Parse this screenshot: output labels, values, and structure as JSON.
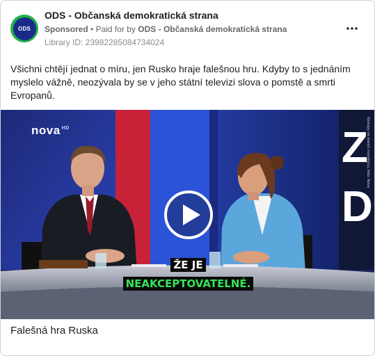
{
  "post": {
    "page_name": "ODS - Občanská demokratická strana",
    "avatar_text": "ODS",
    "sponsored": "Sponsored",
    "paid_for_prefix": "Paid for by",
    "paid_for_name": "ODS - Občanská demokratická strana",
    "library_id": "Library ID: 23982285084734024",
    "body": "Všichni chtějí jednat o míru, jen Rusko hraje falešnou hru. Kdyby to s jednáním myslelo vážně, neozývala by se v jeho státní televizi slova o pomstě a smrti Evropanů.",
    "caption": "Falešná hra Ruska"
  },
  "video": {
    "subtitle_line1": "ŽE JE",
    "subtitle_line2": "NEAKCEPTOVATELNÉ.",
    "channel_logo": "nova",
    "channel_logo_suffix": "HD",
    "set_letters": "ZD",
    "side_credit": "Výstupy ve stanici novinky.cz, foto: Nova"
  },
  "icons": {
    "more": "more-horizontal-icon",
    "play": "play-icon"
  },
  "colors": {
    "avatar_ring": "#1fb04a",
    "avatar_fill": "#1a2a8a",
    "subtitle_green": "#37e35a",
    "studio_blue": "#2a4fd6",
    "studio_red": "#d8243a"
  }
}
